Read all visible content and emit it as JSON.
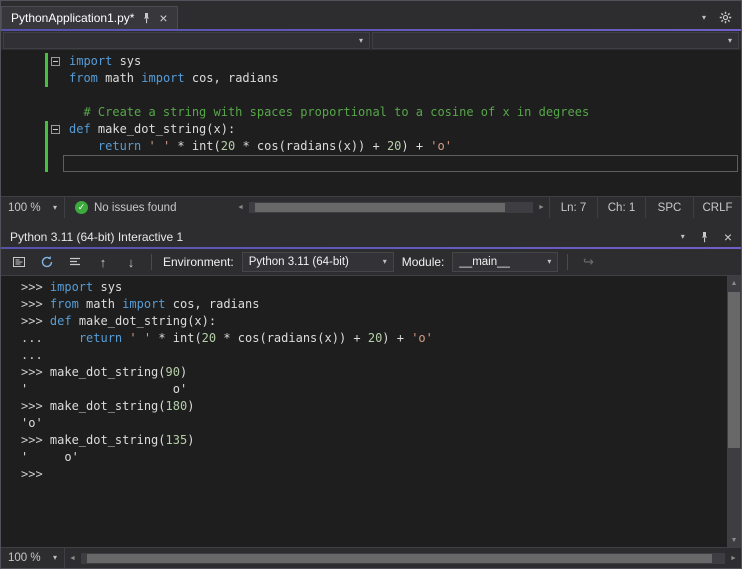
{
  "icons": {
    "dropdown": "▾",
    "close": "×",
    "check": "✓",
    "history_up": "↑",
    "history_down": "↓",
    "send": "↪",
    "scroll_left": "◄",
    "scroll_right": "►",
    "scroll_up": "▲",
    "scroll_down": "▼"
  },
  "colors": {
    "accent": "#605cc0",
    "keyword": "#569cd6",
    "comment": "#57a64a",
    "string": "#d69d85",
    "number": "#b5cea8",
    "change_bar": "#45c13f",
    "health_ok": "#3daa3d"
  },
  "editor": {
    "tab": {
      "title": "PythonApplication1.py*"
    },
    "nav_bar": {
      "left_value": "",
      "right_value": ""
    },
    "code_lines": [
      {
        "fold": true,
        "changed": true,
        "tokens": [
          [
            "kw",
            "import"
          ],
          [
            "pl",
            " sys"
          ]
        ]
      },
      {
        "changed": true,
        "tokens": [
          [
            "kw",
            "from"
          ],
          [
            "pl",
            " math "
          ],
          [
            "kw",
            "import"
          ],
          [
            "pl",
            " cos, radians"
          ]
        ]
      },
      {
        "tokens": []
      },
      {
        "tokens": [
          [
            "pl",
            "  "
          ],
          [
            "com",
            "# Create a string with spaces proportional to a cosine of x in degrees"
          ]
        ]
      },
      {
        "fold": true,
        "changed": true,
        "tokens": [
          [
            "kw",
            "def"
          ],
          [
            "pl",
            " make_dot_string(x):"
          ]
        ]
      },
      {
        "changed": true,
        "tokens": [
          [
            "pl",
            "    "
          ],
          [
            "kw",
            "return"
          ],
          [
            "pl",
            " "
          ],
          [
            "str",
            "' '"
          ],
          [
            "pl",
            " * int("
          ],
          [
            "num",
            "20"
          ],
          [
            "pl",
            " * cos(radians(x)) + "
          ],
          [
            "num",
            "20"
          ],
          [
            "pl",
            ") + "
          ],
          [
            "str",
            "'o'"
          ]
        ]
      },
      {
        "changed": true,
        "current": true,
        "tokens": []
      }
    ],
    "status_bar": {
      "zoom": "100 %",
      "issues": "No issues found",
      "line": "Ln: 7",
      "column": "Ch: 1",
      "spaces": "SPC",
      "line_ending": "CRLF"
    }
  },
  "interactive": {
    "title": "Python 3.11 (64-bit) Interactive 1",
    "toolbar": {
      "environment_label": "Environment:",
      "environment_value": "Python 3.11 (64-bit)",
      "module_label": "Module:",
      "module_value": "__main__"
    },
    "repl_lines": [
      {
        "tokens": [
          [
            "prm",
            ">>> "
          ],
          [
            "kw",
            "import"
          ],
          [
            "pl",
            " sys"
          ]
        ]
      },
      {
        "tokens": [
          [
            "prm",
            ">>> "
          ],
          [
            "kw",
            "from"
          ],
          [
            "pl",
            " math "
          ],
          [
            "kw",
            "import"
          ],
          [
            "pl",
            " cos, radians"
          ]
        ]
      },
      {
        "tokens": [
          [
            "prm",
            ">>> "
          ],
          [
            "kw",
            "def"
          ],
          [
            "pl",
            " make_dot_string(x):"
          ]
        ]
      },
      {
        "tokens": [
          [
            "prm",
            "... "
          ],
          [
            "pl",
            "    "
          ],
          [
            "kw",
            "return"
          ],
          [
            "pl",
            " "
          ],
          [
            "str",
            "' '"
          ],
          [
            "pl",
            " * int("
          ],
          [
            "num",
            "20"
          ],
          [
            "pl",
            " * cos(radians(x)) + "
          ],
          [
            "num",
            "20"
          ],
          [
            "pl",
            ") + "
          ],
          [
            "str",
            "'o'"
          ]
        ]
      },
      {
        "tokens": [
          [
            "prm",
            "..."
          ]
        ]
      },
      {
        "tokens": [
          [
            "prm",
            ">>> "
          ],
          [
            "pl",
            "make_dot_string("
          ],
          [
            "num",
            "90"
          ],
          [
            "pl",
            ")"
          ]
        ]
      },
      {
        "tokens": [
          [
            "pl",
            "'                    o'"
          ]
        ]
      },
      {
        "tokens": [
          [
            "prm",
            ">>> "
          ],
          [
            "pl",
            "make_dot_string("
          ],
          [
            "num",
            "180"
          ],
          [
            "pl",
            ")"
          ]
        ]
      },
      {
        "tokens": [
          [
            "pl",
            "'o'"
          ]
        ]
      },
      {
        "tokens": [
          [
            "prm",
            ">>> "
          ],
          [
            "pl",
            "make_dot_string("
          ],
          [
            "num",
            "135"
          ],
          [
            "pl",
            ")"
          ]
        ]
      },
      {
        "tokens": [
          [
            "pl",
            "'     o'"
          ]
        ]
      },
      {
        "tokens": [
          [
            "prm",
            ">>> "
          ]
        ]
      }
    ],
    "status_bar": {
      "zoom": "100 %"
    }
  }
}
